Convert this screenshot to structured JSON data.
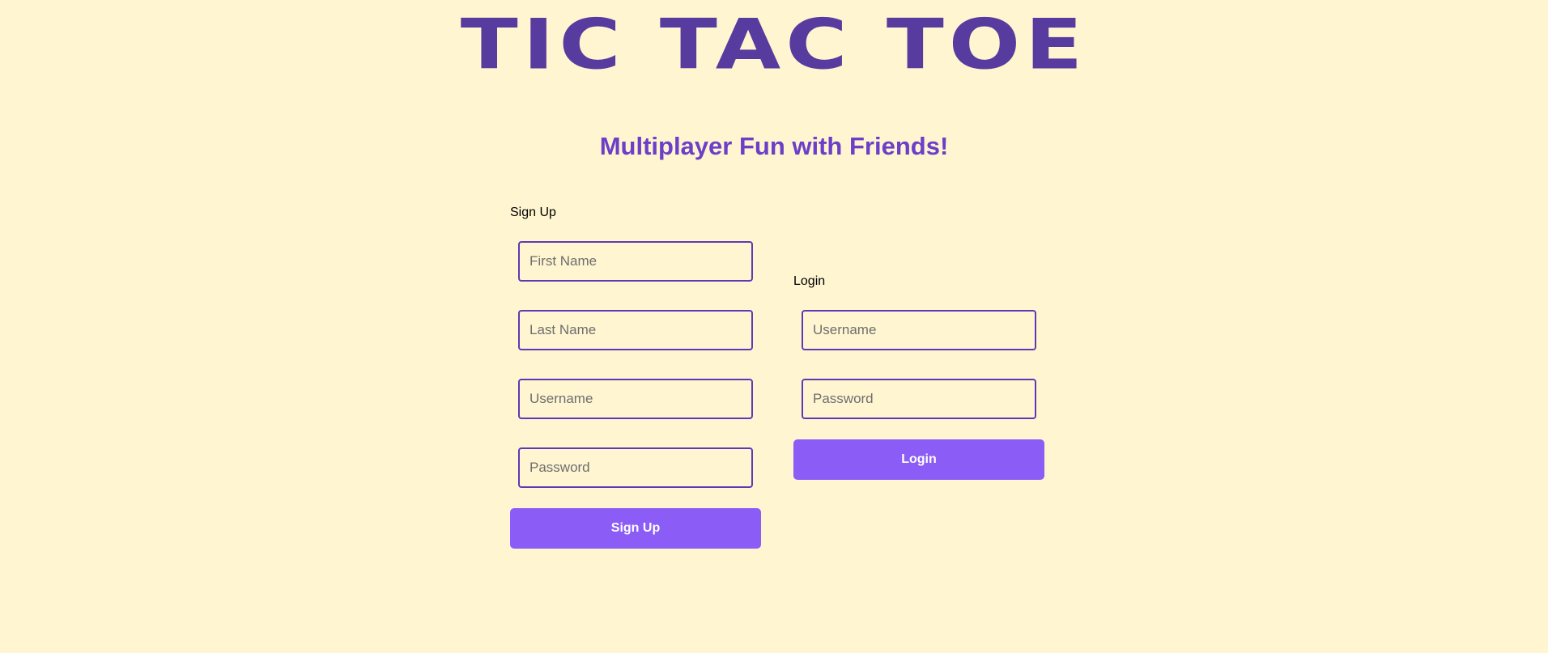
{
  "header": {
    "title": "TIC TAC TOE",
    "subtitle": "Multiplayer Fun with Friends!"
  },
  "signup": {
    "label": "Sign Up",
    "first_name_placeholder": "First Name",
    "last_name_placeholder": "Last Name",
    "username_placeholder": "Username",
    "password_placeholder": "Password",
    "button_label": "Sign Up"
  },
  "login": {
    "label": "Login",
    "username_placeholder": "Username",
    "password_placeholder": "Password",
    "button_label": "Login"
  },
  "colors": {
    "background": "#FFF5D1",
    "title": "#583B9E",
    "subtitle": "#6B3FC7",
    "input_border": "#5B3BB5",
    "button": "#8B5CF6"
  }
}
